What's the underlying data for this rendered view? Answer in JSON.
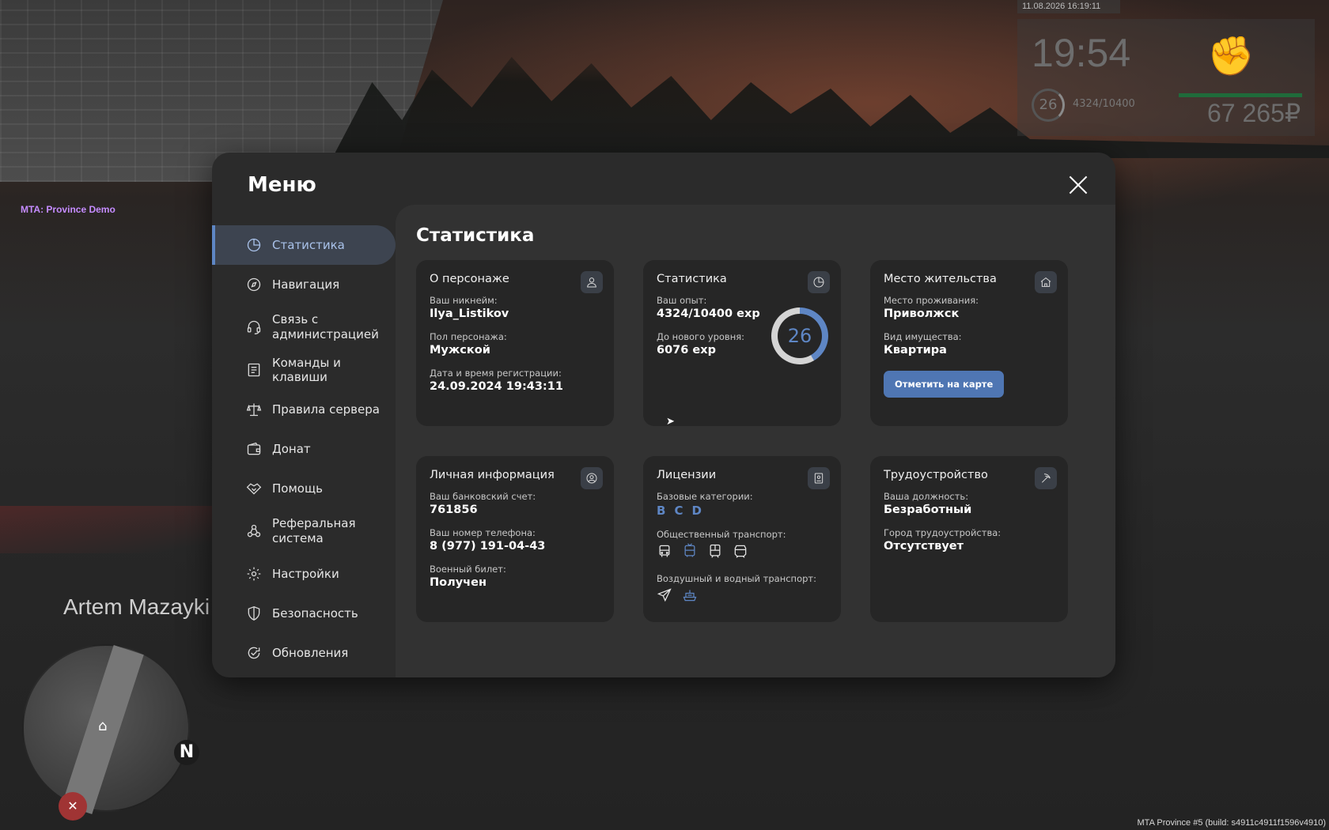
{
  "hud": {
    "datetime": "11.08.2026 16:19:11",
    "time": "19:54",
    "level": "26",
    "exp": "4324/10400",
    "money": "67 265₽"
  },
  "overlay": {
    "server_tag": "MTA: Province Demo",
    "player_name": "Artem Mazayki",
    "build_info": "MTA Province #5 (build: s4911c4911f1596v4910)",
    "compass": "N"
  },
  "modal": {
    "title": "Меню",
    "nav": [
      {
        "label": "Статистика",
        "icon": "pie-chart-icon",
        "active": true
      },
      {
        "label": "Навигация",
        "icon": "compass-icon"
      },
      {
        "label": "Связь с администрацией",
        "icon": "headset-icon"
      },
      {
        "label": "Команды и клавиши",
        "icon": "document-icon"
      },
      {
        "label": "Правила сервера",
        "icon": "scales-icon"
      },
      {
        "label": "Донат",
        "icon": "wallet-icon"
      },
      {
        "label": "Помощь",
        "icon": "handshake-icon"
      },
      {
        "label": "Реферальная система",
        "icon": "network-icon"
      },
      {
        "label": "Настройки",
        "icon": "gear-icon"
      },
      {
        "label": "Безопасность",
        "icon": "shield-icon"
      },
      {
        "label": "Обновления",
        "icon": "refresh-check-icon"
      }
    ]
  },
  "content": {
    "title": "Статистика",
    "character": {
      "title": "О персонаже",
      "nick_label": "Ваш никнейм:",
      "nick": "Ilya_Listikov",
      "gender_label": "Пол персонажа:",
      "gender": "Мужской",
      "reg_label": "Дата и время регистрации:",
      "reg": "24.09.2024 19:43:11"
    },
    "stats": {
      "title": "Статистика",
      "exp_label": "Ваш опыт:",
      "exp": "4324/10400 exp",
      "next_label": "До нового уровня:",
      "next": "6076 exp",
      "level": "26",
      "progress": 0.4158
    },
    "residence": {
      "title": "Место жительства",
      "place_label": "Место проживания:",
      "place": "Приволжск",
      "property_label": "Вид имущества:",
      "property": "Квартира",
      "button": "Отметить на карте"
    },
    "personal": {
      "title": "Личная информация",
      "bank_label": "Ваш банковский счет:",
      "bank": "761856",
      "phone_label": "Ваш номер телефона:",
      "phone": "8 (977) 191-04-43",
      "military_label": "Военный билет:",
      "military": "Получен"
    },
    "licenses": {
      "title": "Лицензии",
      "base_label": "Базовые категории:",
      "categories": [
        "B",
        "C",
        "D"
      ],
      "public_label": "Общественный транспорт:",
      "air_label": "Воздушный и водный транспорт:"
    },
    "employment": {
      "title": "Трудоустройство",
      "position_label": "Ваша должность:",
      "position": "Безработный",
      "city_label": "Город трудоустройства:",
      "city": "Отсутствует"
    }
  },
  "colors": {
    "accent": "#5e86c4",
    "active_bg": "#3d4450",
    "modal_bg": "#2b2b2b",
    "card_bg": "#262626"
  }
}
